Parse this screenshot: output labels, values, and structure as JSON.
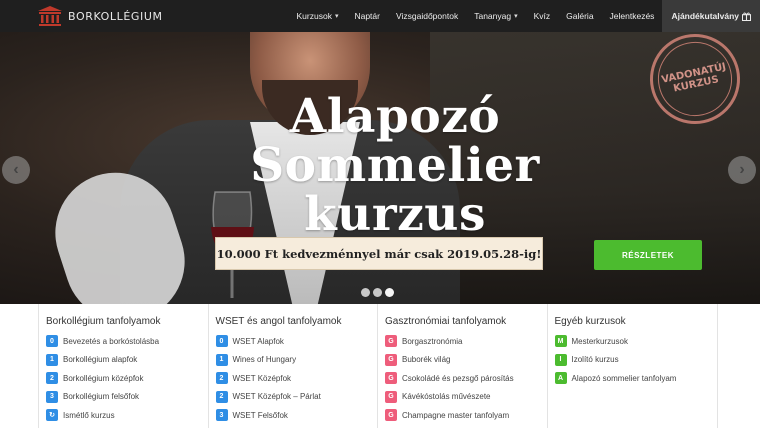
{
  "brand": {
    "name": "BORKOLLÉGIUM",
    "icon": "building-columns-icon"
  },
  "nav": {
    "items": [
      {
        "label": "Kurzusok",
        "dropdown": true
      },
      {
        "label": "Naptár",
        "dropdown": false
      },
      {
        "label": "Vizsgaidőpontok",
        "dropdown": false
      },
      {
        "label": "Tananyag",
        "dropdown": true
      },
      {
        "label": "Kvíz",
        "dropdown": false
      },
      {
        "label": "Galéria",
        "dropdown": false
      },
      {
        "label": "Jelentkezés",
        "dropdown": false
      }
    ],
    "gift": {
      "label": "Ajándékutalvány",
      "icon": "gift-icon"
    }
  },
  "hero": {
    "headline": [
      "Alapozó",
      "Sommelier",
      "kurzus"
    ],
    "stamp": [
      "VADONATÚJ",
      "KURZUS"
    ],
    "promo": "10.000 Ft kedvezménnyel már csak 2019.05.28-ig!",
    "cta": "RÉSZLETEK",
    "prev_icon": "chevron-left-icon",
    "next_icon": "chevron-right-icon",
    "slides": 3,
    "active_slide": 2
  },
  "colors": {
    "blue": "#2f8ee5",
    "pink": "#ee5d7b",
    "green": "#4cbb2f",
    "nav_bg": "#1f1f1f"
  },
  "columns": [
    {
      "title": "Borkollégium tanfolyamok",
      "items": [
        {
          "badge": "0",
          "color": "#2f8ee5",
          "label": "Bevezetés a borkóstolásba"
        },
        {
          "badge": "1",
          "color": "#2f8ee5",
          "label": "Borkollégium alapfok"
        },
        {
          "badge": "2",
          "color": "#2f8ee5",
          "label": "Borkollégium középfok"
        },
        {
          "badge": "3",
          "color": "#2f8ee5",
          "label": "Borkollégium felsőfok"
        },
        {
          "badge": "↻",
          "color": "#2f8ee5",
          "label": "Ismétlő kurzus"
        }
      ]
    },
    {
      "title": "WSET és angol tanfolyamok",
      "items": [
        {
          "badge": "0",
          "color": "#2f8ee5",
          "label": "WSET Alapfok"
        },
        {
          "badge": "1",
          "color": "#2f8ee5",
          "label": "Wines of Hungary"
        },
        {
          "badge": "2",
          "color": "#2f8ee5",
          "label": "WSET Középfok"
        },
        {
          "badge": "2",
          "color": "#2f8ee5",
          "label": "WSET Középfok – Párlat"
        },
        {
          "badge": "3",
          "color": "#2f8ee5",
          "label": "WSET Felsőfok"
        }
      ]
    },
    {
      "title": "Gasztronómiai tanfolyamok",
      "items": [
        {
          "badge": "G",
          "color": "#ee5d7b",
          "label": "Borgasztronómia"
        },
        {
          "badge": "G",
          "color": "#ee5d7b",
          "label": "Buborék világ"
        },
        {
          "badge": "G",
          "color": "#ee5d7b",
          "label": "Csokoládé és pezsgő párosítás"
        },
        {
          "badge": "G",
          "color": "#ee5d7b",
          "label": "Kávékóstolás művészete"
        },
        {
          "badge": "G",
          "color": "#ee5d7b",
          "label": "Champagne master tanfolyam"
        }
      ]
    },
    {
      "title": "Egyéb kurzusok",
      "items": [
        {
          "badge": "M",
          "color": "#4cbb2f",
          "label": "Mesterkurzusok"
        },
        {
          "badge": "I",
          "color": "#4cbb2f",
          "label": "Izolító kurzus"
        },
        {
          "badge": "A",
          "color": "#4cbb2f",
          "label": "Alapozó sommelier tanfolyam"
        }
      ]
    }
  ]
}
